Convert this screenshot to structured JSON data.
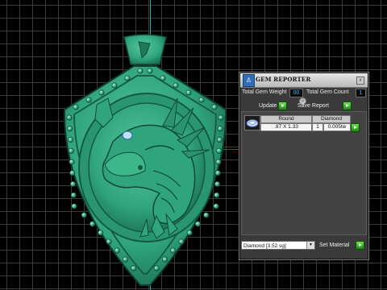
{
  "panel": {
    "title": "GEM REPORTER",
    "close_glyph": "x",
    "logo_glyph": "♙",
    "weight_label": "Total Gem Weight",
    "weight_value": "00",
    "count_label": "Total Gem Count",
    "count_value": "1",
    "update_label": "Update",
    "save_label": "Save Report",
    "toggle_glyph": "◎"
  },
  "gem_table": {
    "headers": [
      "Round",
      "Diamond"
    ],
    "row": {
      "size": ".87 X 1.33",
      "count": "1",
      "weight": "0.005tw"
    }
  },
  "footer": {
    "material": "Diamond   [3.52 sg]",
    "set_material_label": "Set Material"
  },
  "colors": {
    "pendant": "#2fa47d",
    "pendant_dark": "#1b6e52",
    "panel_bg": "#3a3a3a",
    "value_text": "#41b5ff",
    "button_green": "#2fbf1f"
  },
  "icons": {
    "logo": "gem-reporter-logo-icon",
    "gem": "round-gem-icon",
    "dropdown": "chevron-down-icon",
    "play": "play-icon"
  }
}
